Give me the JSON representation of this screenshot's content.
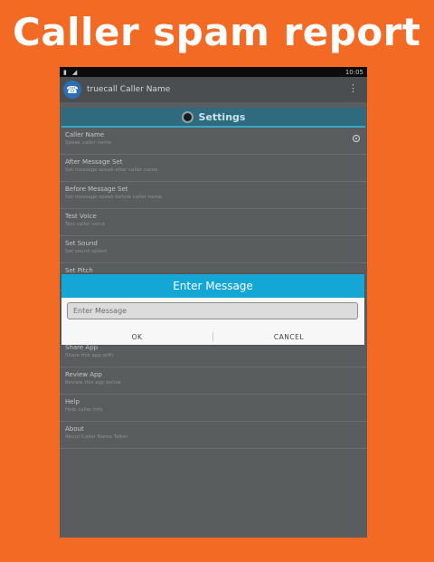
{
  "headline": "Caller spam report",
  "status_bar": {
    "time": "10:05"
  },
  "app": {
    "title": "truecall Caller Name"
  },
  "settings": {
    "header": "Settings"
  },
  "preferences_top": [
    {
      "title": "Caller Name",
      "summary": "Speak caller name"
    },
    {
      "title": "After Message Set",
      "summary": "Set message speak after caller name"
    },
    {
      "title": "Before Message Set",
      "summary": "Set message speak before caller name"
    },
    {
      "title": "Test Voice",
      "summary": "Test caller voice"
    },
    {
      "title": "Set Sound",
      "summary": "Set sound speed"
    },
    {
      "title": "Set Pitch",
      "summary": ""
    }
  ],
  "preferences_bottom": [
    {
      "title": "Share App",
      "summary": "Share this app with"
    },
    {
      "title": "Review App",
      "summary": "Review this app below"
    },
    {
      "title": "Help",
      "summary": "Help caller info"
    },
    {
      "title": "About",
      "summary": "About Caller Name Talker"
    }
  ],
  "dialog": {
    "title": "Enter Message",
    "input_placeholder": "Enter Message",
    "ok_label": "OK",
    "cancel_label": "CANCEL"
  },
  "colors": {
    "background": "#f26a24",
    "dialog_title": "#14a7d6",
    "settings_header": "#2f6a7e"
  }
}
